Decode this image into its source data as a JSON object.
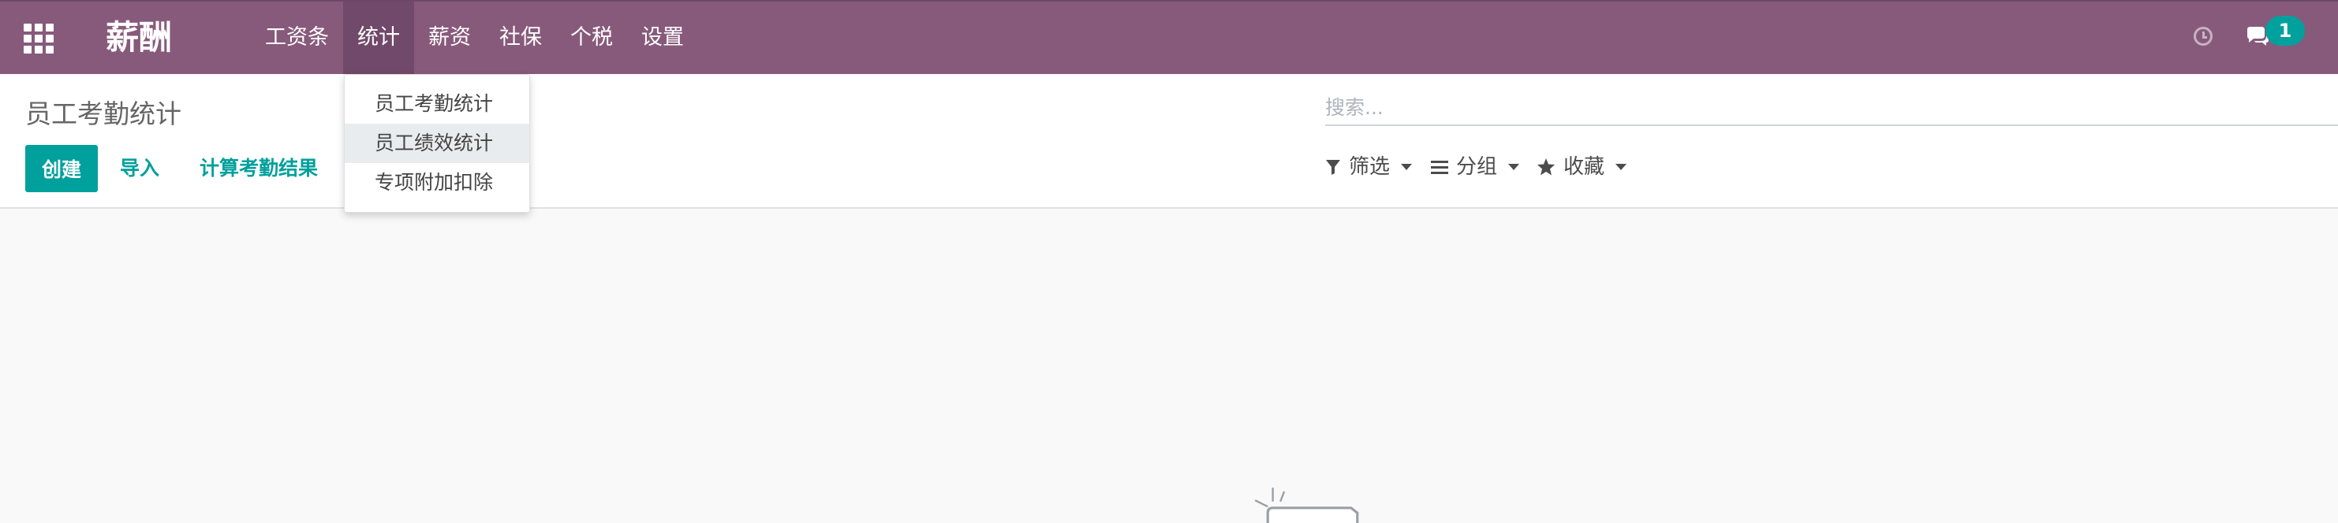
{
  "navbar": {
    "brand": "薪酬",
    "menu": [
      {
        "label": "工资条"
      },
      {
        "label": "统计"
      },
      {
        "label": "薪资"
      },
      {
        "label": "社保"
      },
      {
        "label": "个税"
      },
      {
        "label": "设置"
      }
    ],
    "active_menu": "统计",
    "message_count": "1",
    "colors": {
      "bar": "#875a7b",
      "active": "#71496a",
      "badge": "#00a09d"
    }
  },
  "dropdown": {
    "items": [
      {
        "label": "员工考勤统计"
      },
      {
        "label": "员工绩效统计"
      },
      {
        "label": "专项附加扣除"
      }
    ],
    "hovered": "员工绩效统计"
  },
  "control_panel": {
    "breadcrumb": "员工考勤统计",
    "create_label": "创建",
    "import_label": "导入",
    "compute_label": "计算考勤结果",
    "search_placeholder": "搜索...",
    "filter_label": "筛选",
    "group_label": "分组",
    "favorites_label": "收藏",
    "accent_color": "#00a09d"
  },
  "icons": {
    "apps": "apps-grid-icon",
    "clock": "clock-icon",
    "chat": "chat-icon",
    "filter": "filter-icon",
    "group": "list-icon",
    "favorites": "star-icon"
  }
}
